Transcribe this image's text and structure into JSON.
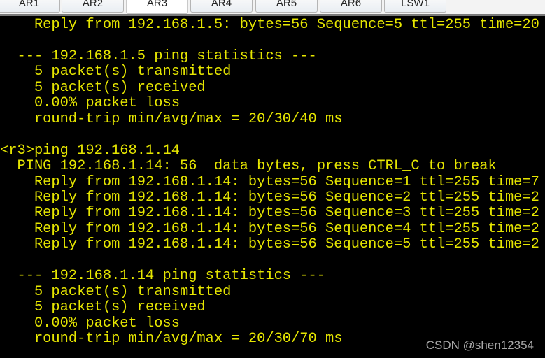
{
  "tabs": [
    {
      "label": "AR1"
    },
    {
      "label": "AR2"
    },
    {
      "label": "AR3",
      "active": true
    },
    {
      "label": "AR4"
    },
    {
      "label": "AR5"
    },
    {
      "label": "AR6"
    },
    {
      "label": "LSW1"
    }
  ],
  "terminal": {
    "text_color": "#e6e600",
    "background": "#000000",
    "lines": [
      "    Reply from 192.168.1.5: bytes=56 Sequence=5 ttl=255 time=20",
      "",
      "  --- 192.168.1.5 ping statistics ---",
      "    5 packet(s) transmitted",
      "    5 packet(s) received",
      "    0.00% packet loss",
      "    round-trip min/avg/max = 20/30/40 ms",
      "",
      "<r3>ping 192.168.1.14",
      "  PING 192.168.1.14: 56  data bytes, press CTRL_C to break",
      "    Reply from 192.168.1.14: bytes=56 Sequence=1 ttl=255 time=7",
      "    Reply from 192.168.1.14: bytes=56 Sequence=2 ttl=255 time=2",
      "    Reply from 192.168.1.14: bytes=56 Sequence=3 ttl=255 time=2",
      "    Reply from 192.168.1.14: bytes=56 Sequence=4 ttl=255 time=2",
      "    Reply from 192.168.1.14: bytes=56 Sequence=5 ttl=255 time=2",
      "",
      "  --- 192.168.1.14 ping statistics ---",
      "    5 packet(s) transmitted",
      "    5 packet(s) received",
      "    0.00% packet loss",
      "    round-trip min/avg/max = 20/30/70 ms"
    ]
  },
  "watermark": "CSDN @shen12354"
}
